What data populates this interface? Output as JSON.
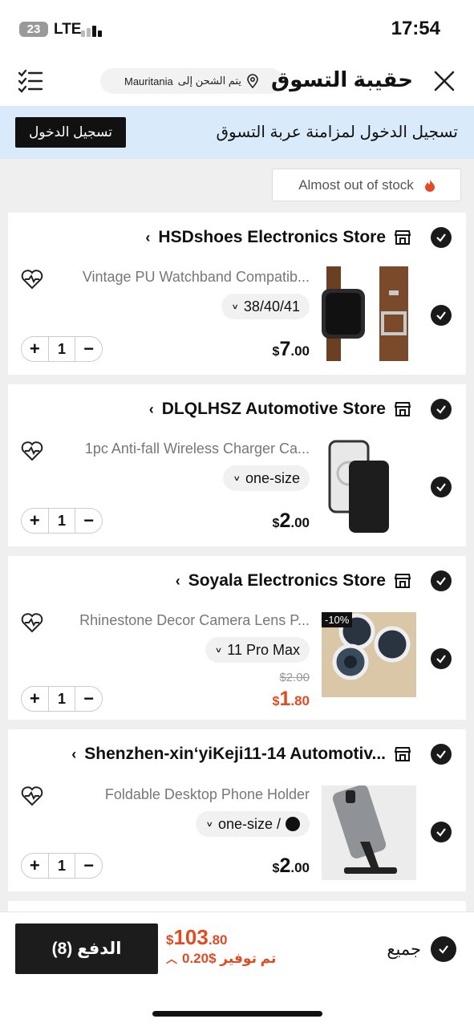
{
  "status_bar": {
    "battery": "23",
    "network": "LTE",
    "time": "17:54"
  },
  "header": {
    "title": "حقيبة التسوق",
    "ship_prefix": "يتم الشحن إلى",
    "ship_country": "Mauritania"
  },
  "login_banner": {
    "text": "تسجيل الدخول لمزامنة عربة التسوق",
    "button": "تسجيل الدخول"
  },
  "stock_notice": "Almost out of stock",
  "stores": [
    {
      "name": "HSDshoes Electronics Store",
      "item": {
        "title": "Vintage PU Watchband Compatib...",
        "variant": "38/40/41",
        "currency": "$",
        "price_int": "7",
        "price_dec": ".00",
        "quantity": "1"
      }
    },
    {
      "name": "DLQLHSZ Automotive Store",
      "item": {
        "title": "1pc Anti-fall Wireless Charger Ca...",
        "variant": "one-size",
        "currency": "$",
        "price_int": "2",
        "price_dec": ".00",
        "quantity": "1"
      }
    },
    {
      "name": "Soyala Electronics Store",
      "item": {
        "title": "Rhinestone Decor Camera Lens P...",
        "variant": "11 Pro Max",
        "currency": "$",
        "price_int": "1",
        "price_dec": ".80",
        "old_price": "$2.00",
        "discount": "-10%",
        "quantity": "1"
      }
    },
    {
      "name": "Shenzhen-xin‘yiKeji11-14 Automotiv...",
      "item": {
        "title": "Foldable Desktop Phone Holder",
        "variant": "one-size /",
        "currency": "$",
        "price_int": "2",
        "price_dec": ".00",
        "quantity": "1"
      }
    }
  ],
  "footer": {
    "pay_label": "الدفع (8)",
    "total_currency": "$",
    "total_int": "103",
    "total_dec": ".80",
    "savings": "تم توفير $0.20",
    "select_all": "جميع"
  },
  "colors": {
    "accent": "#e14a23",
    "banner": "#d9ebfb",
    "dark": "#111111"
  }
}
